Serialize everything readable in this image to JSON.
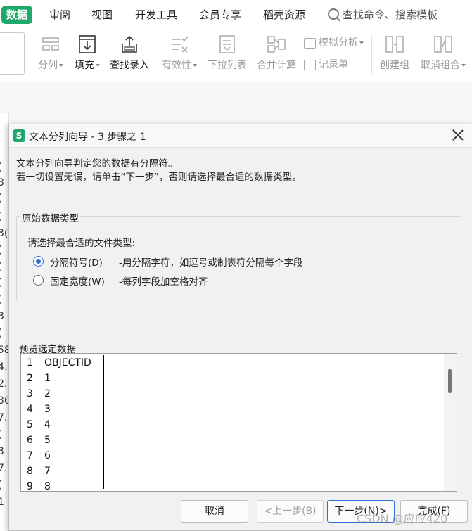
{
  "ribbon": {
    "tabs": [
      {
        "label": "数据",
        "active": true
      },
      {
        "label": "审阅"
      },
      {
        "label": "视图"
      },
      {
        "label": "开发工具"
      },
      {
        "label": "会员专享"
      },
      {
        "label": "稻壳资源"
      }
    ],
    "search_label": "查找命令、搜索模板",
    "tools": {
      "split": "分列",
      "fill": "填充",
      "find_entry": "查找录入",
      "validity": "有效性",
      "dropdown": "下拉列表",
      "merge_calc": "合并计算",
      "simulate": "模拟分析",
      "record": "记录单",
      "create_group": "创建组",
      "ungroup": "取消组合"
    }
  },
  "sheet": {
    "fragments": [
      "(",
      "3",
      "(",
      "(",
      "3(",
      "(",
      "(",
      "(",
      "(",
      "3",
      "(",
      "58",
      "4.",
      "2.",
      "36",
      "7.",
      "(",
      "3",
      "7.",
      "(",
      "1"
    ]
  },
  "dialog": {
    "logo": "S",
    "title": "文本分列向导 - 3 步骤之 1",
    "intro_line1": "文本分列向导判定您的数据有分隔符。",
    "intro_line2": "若一切设置无误，请单击“下一步”，否则请选择最合适的数据类型。",
    "group_label": "原始数据类型",
    "prompt": "请选择最合适的文件类型:",
    "options": [
      {
        "label": "分隔符号(D)",
        "desc": "-用分隔字符，如逗号或制表符分隔每个字段",
        "checked": true
      },
      {
        "label": "固定宽度(W)",
        "desc": "-每列字段加空格对齐",
        "checked": false
      }
    ],
    "preview_label": "预览选定数据",
    "preview_rows": [
      {
        "n": "1",
        "v": "OBJECTID"
      },
      {
        "n": "2",
        "v": "1"
      },
      {
        "n": "3",
        "v": "2"
      },
      {
        "n": "4",
        "v": "3"
      },
      {
        "n": "5",
        "v": "4"
      },
      {
        "n": "6",
        "v": "5"
      },
      {
        "n": "7",
        "v": "6"
      },
      {
        "n": "8",
        "v": "7"
      },
      {
        "n": "9",
        "v": "8"
      }
    ],
    "buttons": {
      "cancel": "取消",
      "prev": "<上一步(B)",
      "next": "下一步(N)>",
      "finish": "完成(F)"
    }
  },
  "watermark": "CSDN @应应420",
  "colors": {
    "accent": "#1fa86a",
    "radio": "#2f6fd6"
  }
}
